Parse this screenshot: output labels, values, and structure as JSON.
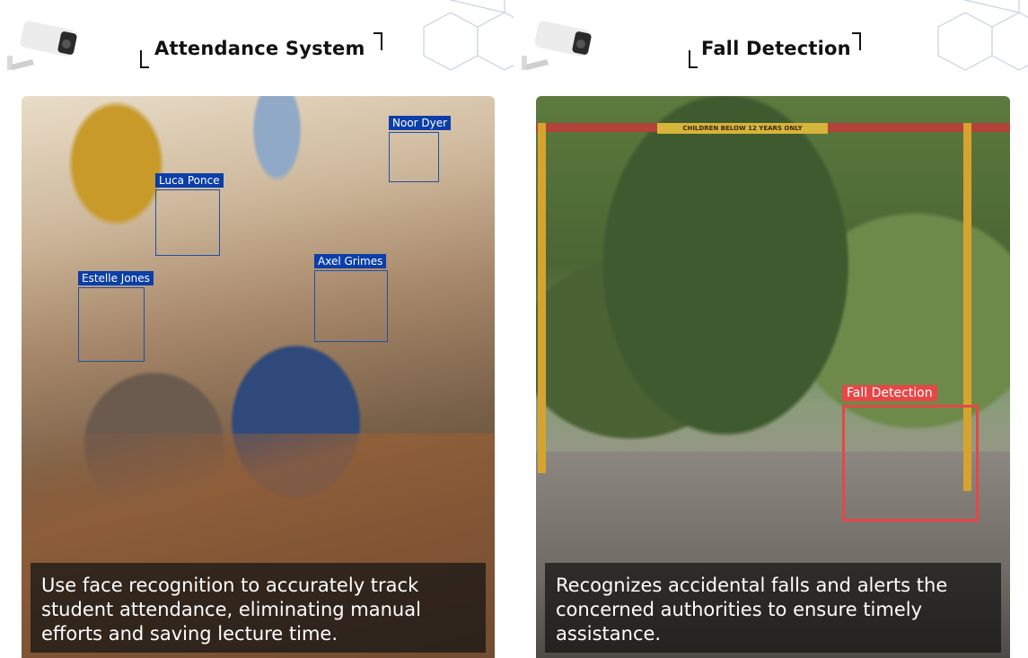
{
  "attendance": {
    "title": "Attendance System",
    "faces": [
      {
        "name": "Noor Dyer"
      },
      {
        "name": "Luca Ponce"
      },
      {
        "name": "Axel Grimes"
      },
      {
        "name": "Estelle Jones"
      }
    ],
    "caption": "Use face recognition to accurately track student attendance, eliminating manual efforts and saving lecture time.",
    "box_color": "#1f4fa8",
    "label_color": "#0b3ea8"
  },
  "fall": {
    "title": "Fall Detection",
    "sign_text": "CHILDREN BELOW 12 YEARS ONLY",
    "detection_label": "Fall Detection",
    "caption": "Recognizes accidental falls and alerts the concerned authorities to ensure timely assistance.",
    "box_color": "#e84646"
  },
  "icons": {
    "camera": "security-camera-icon",
    "hexagon": "hexagon-pattern-icon"
  }
}
